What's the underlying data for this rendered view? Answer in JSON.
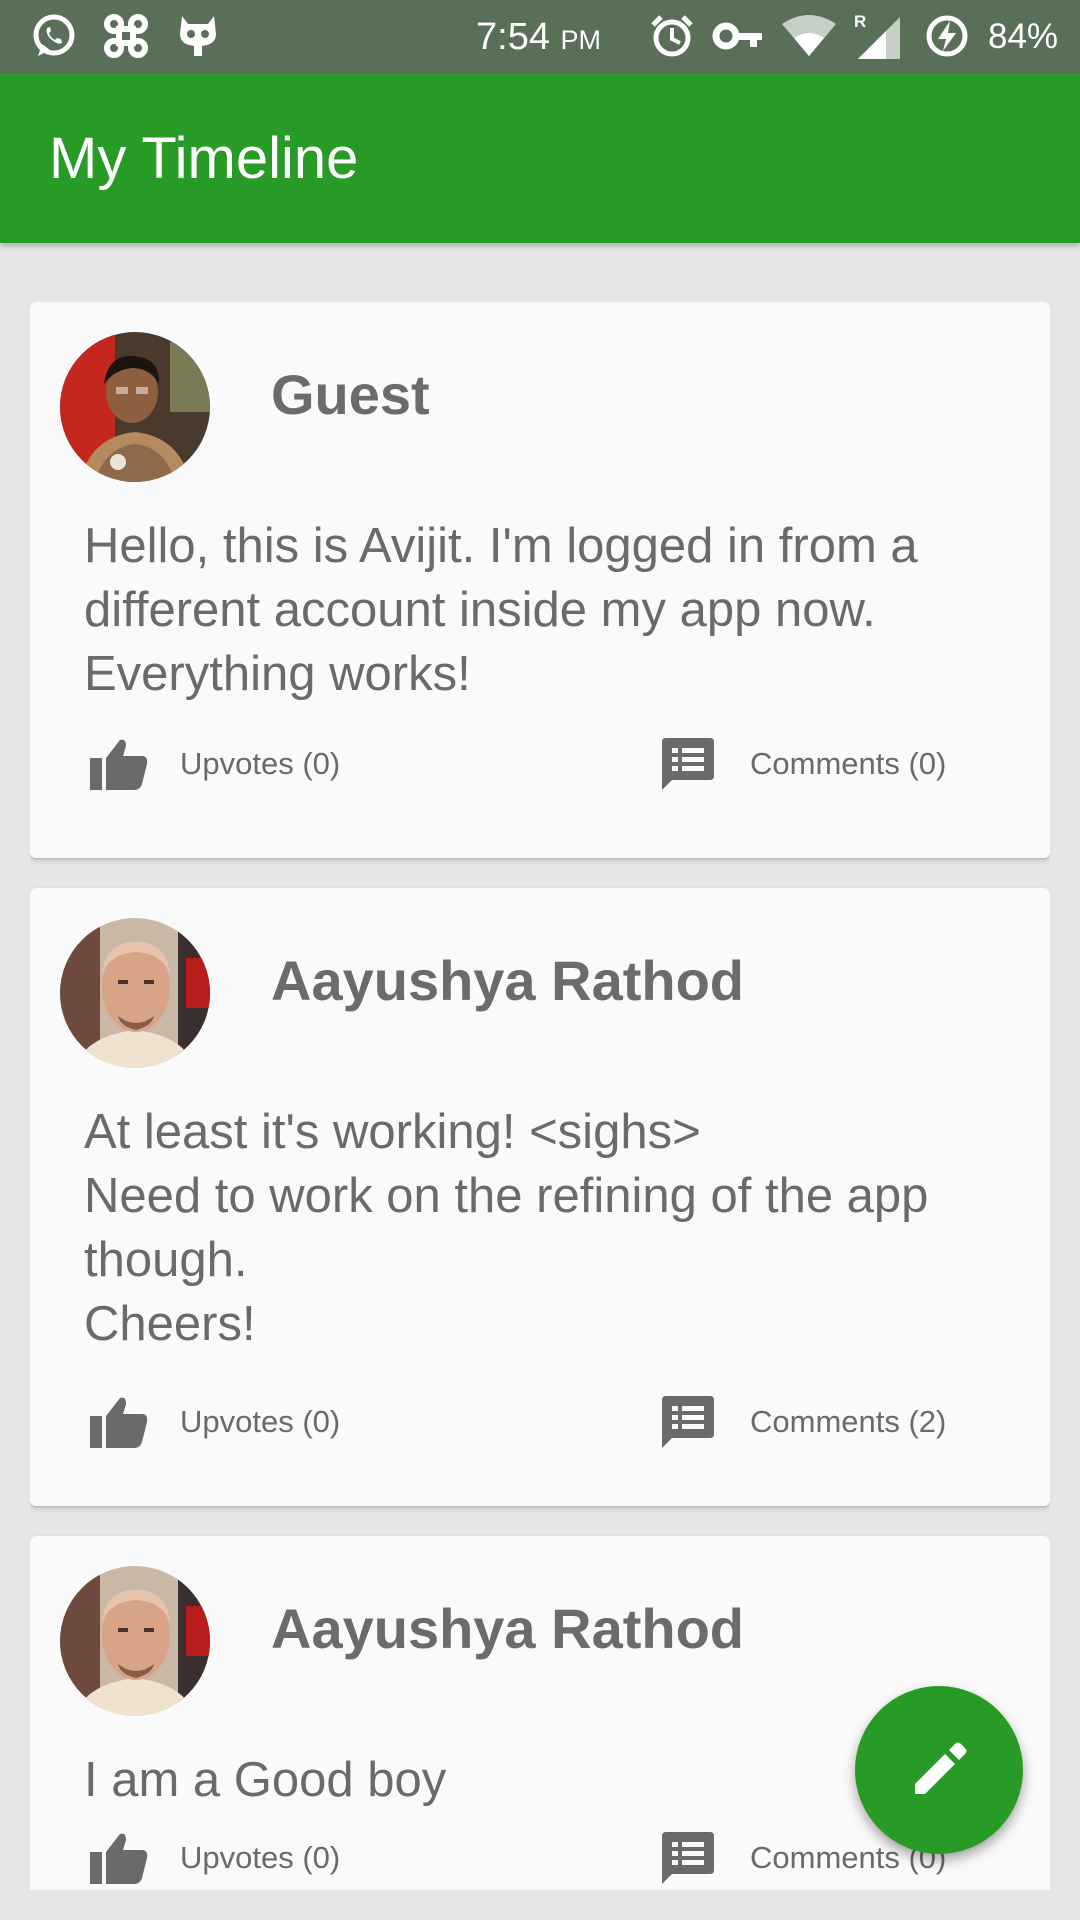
{
  "status_bar": {
    "time": "7:54",
    "ampm": "PM",
    "battery": "84%",
    "network_badge": "R"
  },
  "appbar": {
    "title": "My Timeline"
  },
  "posts": [
    {
      "author": "Guest",
      "text": "Hello, this is Avijit. I'm logged in from a different account inside my app now. Everything works!",
      "upvotes_label": "Upvotes (0)",
      "comments_label": "Comments (0)"
    },
    {
      "author": "Aayushya Rathod",
      "text": "At least it's working! <sighs>\nNeed to work on the refining of the app though.\nCheers!",
      "upvotes_label": "Upvotes (0)",
      "comments_label": "Comments (2)"
    },
    {
      "author": "Aayushya Rathod",
      "text": "I am a Good boy",
      "upvotes_label": "Upvotes (0)",
      "comments_label": "Comments (0)"
    }
  ],
  "icons": {
    "statusbar": [
      "whatsapp-icon",
      "command-icon",
      "cyanogen-icon",
      "alarm-icon",
      "vpn-key-icon",
      "wifi-icon",
      "signal-icon",
      "battery-charging-icon"
    ],
    "upvote": "thumb-up-icon",
    "comment": "comment-icon",
    "fab": "edit-pencil-icon"
  },
  "colors": {
    "primary": "#279b25",
    "statusbar": "#5a6f58",
    "card": "#fafafa",
    "background": "#e6e6e6"
  }
}
